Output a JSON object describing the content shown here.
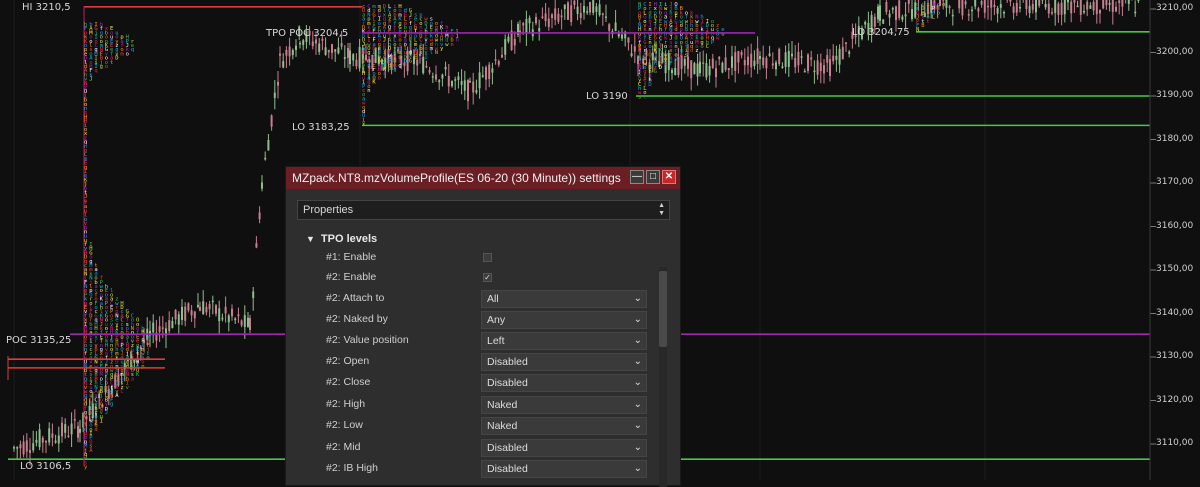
{
  "price_axis": {
    "labels": [
      "3210,00",
      "3200,00",
      "3190,00",
      "3180,00",
      "3170,00",
      "3160,00",
      "3150,00",
      "3140,00",
      "3130,00",
      "3120,00",
      "3110,00"
    ],
    "range": [
      3105,
      3213
    ]
  },
  "level_labels": {
    "hi": "HI 3210,5",
    "tpo_poc": "TPO POC 3204,5",
    "lo_3183": "LO 3183,25",
    "lo_3190": "LO 3190",
    "lo_3204": "LO 3204,75",
    "poc_3135": "POC 3135,25",
    "lo_3106": "LO 3106,5"
  },
  "levels": [
    {
      "kind": "hi",
      "price": 3210.5,
      "color": "#e53935"
    },
    {
      "kind": "poc",
      "price": 3204.5,
      "color": "#9c27b0"
    },
    {
      "kind": "lo",
      "price": 3204.75,
      "color": "#43c943"
    },
    {
      "kind": "lo",
      "price": 3190,
      "color": "#43c943"
    },
    {
      "kind": "lo",
      "price": 3183.25,
      "color": "#43c943"
    },
    {
      "kind": "poc",
      "price": 3135.25,
      "color": "#9c27b0"
    },
    {
      "kind": "hi",
      "price": 3129.5,
      "color": "#e53935"
    },
    {
      "kind": "hi",
      "price": 3127.5,
      "color": "#e53935"
    },
    {
      "kind": "lo",
      "price": 3106.5,
      "color": "#43c943"
    }
  ],
  "dialog": {
    "title": "MZpack.NT8.mzVolumeProfile(ES 06-20 (30 Minute)) settings",
    "minimize_glyph": "—",
    "maximize_glyph": "□",
    "close_glyph": "✕",
    "properties_label": "Properties",
    "section": "TPO levels",
    "rows": [
      {
        "label": "#1: Enable",
        "type": "check",
        "checked": false,
        "mark": ""
      },
      {
        "label": "#2: Enable",
        "type": "check",
        "checked": true,
        "mark": "✓"
      },
      {
        "label": "#2: Attach to",
        "type": "select",
        "value": "All"
      },
      {
        "label": "#2: Naked by",
        "type": "select",
        "value": "Any"
      },
      {
        "label": "#2: Value position",
        "type": "select",
        "value": "Left"
      },
      {
        "label": "#2: Open",
        "type": "select",
        "value": "Disabled"
      },
      {
        "label": "#2: Close",
        "type": "select",
        "value": "Disabled"
      },
      {
        "label": "#2: High",
        "type": "select",
        "value": "Naked"
      },
      {
        "label": "#2: Low",
        "type": "select",
        "value": "Naked"
      },
      {
        "label": "#2: Mid",
        "type": "select",
        "value": "Disabled"
      },
      {
        "label": "#2: IB High",
        "type": "select",
        "value": "Disabled"
      }
    ]
  },
  "colors": {
    "background": "#0f0f0f",
    "candle_up": "#8fbf8f",
    "candle_down": "#c97f8f",
    "tpo_palette": [
      "#e91e63",
      "#ffeb3b",
      "#4caf50",
      "#2196f3",
      "#ff9800",
      "#9c27b0",
      "#00bcd4",
      "#cddc39",
      "#f44336",
      "#ffffff"
    ]
  }
}
